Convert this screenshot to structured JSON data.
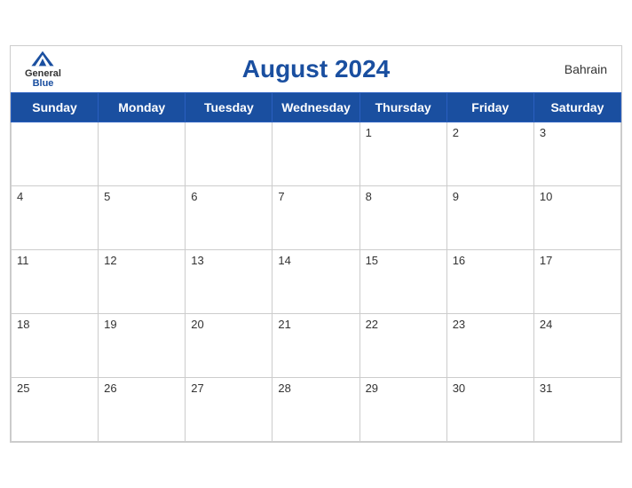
{
  "header": {
    "title": "August 2024",
    "country": "Bahrain",
    "logo": {
      "general": "General",
      "blue": "Blue"
    }
  },
  "days_of_week": [
    "Sunday",
    "Monday",
    "Tuesday",
    "Wednesday",
    "Thursday",
    "Friday",
    "Saturday"
  ],
  "weeks": [
    [
      null,
      null,
      null,
      null,
      1,
      2,
      3
    ],
    [
      4,
      5,
      6,
      7,
      8,
      9,
      10
    ],
    [
      11,
      12,
      13,
      14,
      15,
      16,
      17
    ],
    [
      18,
      19,
      20,
      21,
      22,
      23,
      24
    ],
    [
      25,
      26,
      27,
      28,
      29,
      30,
      31
    ]
  ]
}
